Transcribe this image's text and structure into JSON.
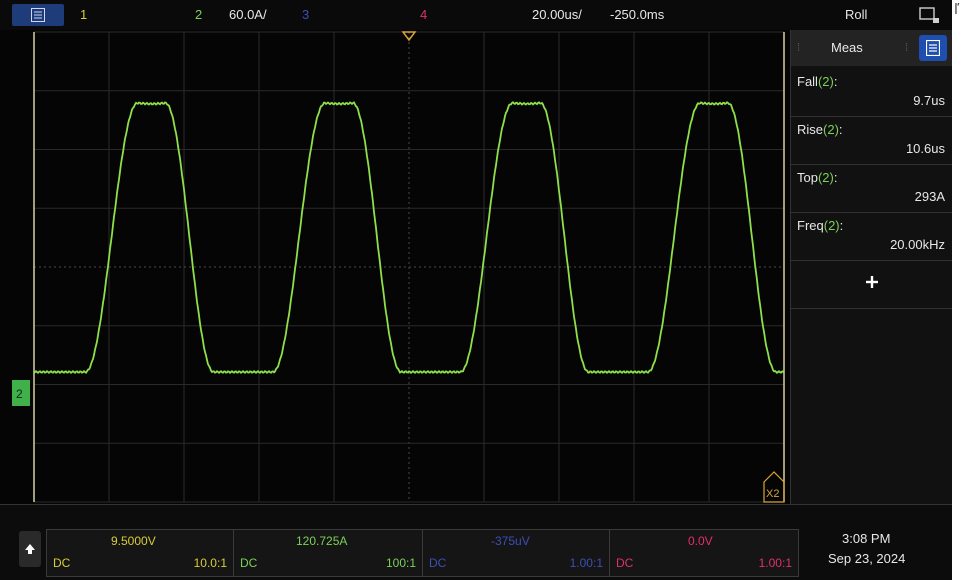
{
  "topbar": {
    "ch1_num": "1",
    "ch2_num": "2",
    "ch2_scale": "60.0A/",
    "ch3_num": "3",
    "ch4_num": "4",
    "timebase": "20.00us/",
    "delay": "-250.0ms",
    "mode": "Roll",
    "icons": [
      "menu-icon",
      "zoom-window-icon"
    ]
  },
  "colors": {
    "ch1": "#d8cc3a",
    "ch2": "#7cd05a",
    "ch3": "#3c4fb8",
    "ch4": "#e0306a",
    "trace": "#8ee04a",
    "trigger": "#d8a53a"
  },
  "plot": {
    "ground_marker": "2",
    "zoom_marker": "X2"
  },
  "measurements": {
    "title": "Meas",
    "items": [
      {
        "name": "Fall",
        "channel": "(2)",
        "suffix": ":",
        "value": "9.7us"
      },
      {
        "name": "Rise",
        "channel": "(2)",
        "suffix": ":",
        "value": "10.6us"
      },
      {
        "name": "Top",
        "channel": "(2)",
        "suffix": ":",
        "value": "293A"
      },
      {
        "name": "Freq",
        "channel": "(2)",
        "suffix": ":",
        "value": "20.00kHz"
      }
    ],
    "icons": [
      "add-measurement-icon",
      "menu-icon"
    ]
  },
  "channels": [
    {
      "value": "9.5000V",
      "coupling": "DC",
      "ratio": "10.0:1"
    },
    {
      "value": "120.725A",
      "coupling": "DC",
      "ratio": "100:1"
    },
    {
      "value": "-375uV",
      "coupling": "DC",
      "ratio": "1.00:1"
    },
    {
      "value": "0.0V",
      "coupling": "DC",
      "ratio": "1.00:1"
    }
  ],
  "clock": {
    "time": "3:08 PM",
    "date": "Sep 23, 2024"
  },
  "waveform": {
    "frequency_khz": 20.0,
    "timebase_us_per_div": 20.0,
    "high_level_a": 293,
    "rise_us": 10.6,
    "fall_us": 9.7
  }
}
